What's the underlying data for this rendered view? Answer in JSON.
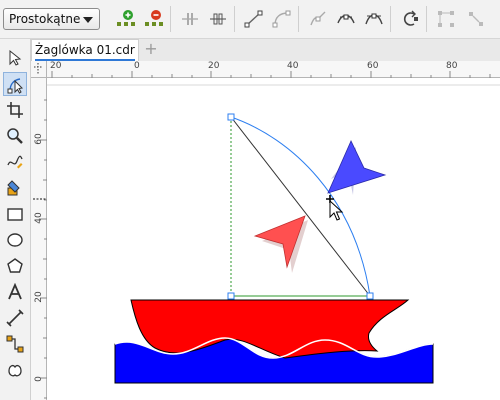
{
  "propertyBar": {
    "shape_mode": "Prostokątne",
    "icons": [
      "add-node-icon",
      "delete-node-icon",
      "break-curve-icon",
      "join-nodes-icon",
      "to-line-icon",
      "to-curve-icon",
      "cusp-node-icon",
      "smooth-node-icon",
      "symmetrical-node-icon",
      "reverse-direction-icon",
      "extract-subpath-icon"
    ]
  },
  "document": {
    "tab_title": "Żaglówka 01.cdr",
    "add_tab_label": "+"
  },
  "toolbox": {
    "tools": [
      "pick-tool",
      "shape-tool",
      "crop-tool",
      "zoom-tool",
      "freehand-tool",
      "smart-fill-tool",
      "rectangle-tool",
      "ellipse-tool",
      "polygon-tool",
      "text-tool",
      "dimension-tool",
      "connector-tool",
      "interactive-tool"
    ],
    "active": "shape-tool"
  },
  "rulers": {
    "horizontal_labels": [
      "20",
      "0",
      "20",
      "40",
      "60",
      "80"
    ],
    "vertical_labels": [
      "60",
      "40",
      "20",
      "0"
    ]
  },
  "drawing": {
    "hull_color": "#ff0000",
    "water_color": "#0000ff",
    "flag_blue": "#4a4aff",
    "flag_red": "#ff5050",
    "selection_color": "#2d7ff0",
    "guide_color": "#2e9a2e"
  }
}
